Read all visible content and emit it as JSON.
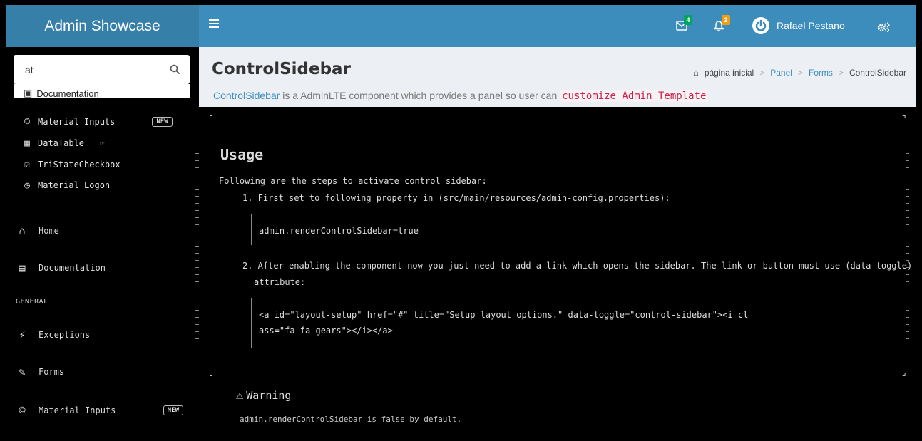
{
  "app": {
    "logo": "Admin Showcase"
  },
  "topbar": {
    "messages_count": "4",
    "notifications_count": "2",
    "user_name": "Rafael Pestano"
  },
  "search": {
    "value": "at"
  },
  "search_results": [
    {
      "label": "Documentation",
      "icon": "book-icon"
    },
    {
      "label": "Material Inputs",
      "icon": "copyright-icon",
      "tag": "NEW"
    },
    {
      "label": "DataTable",
      "icon": "table-icon"
    },
    {
      "label": "TriStateCheckbox",
      "icon": "check-square-icon"
    },
    {
      "label": "Material Logon",
      "icon": "clock-icon"
    }
  ],
  "menu": {
    "home": "Home",
    "documentation": "Documentation",
    "header_general": "GENERAL",
    "exceptions": "Exceptions",
    "forms": "Forms",
    "material_inputs": "Material Inputs",
    "material_inputs_tag": "NEW"
  },
  "page": {
    "title": "ControlSidebar",
    "breadcrumb": [
      "página inicial",
      "Panel",
      "Forms",
      "ControlSidebar"
    ],
    "intro_link": "ControlSidebar",
    "intro_text": " is a AdminLTE component which provides a panel so user can ",
    "intro_code": "customize Admin Template"
  },
  "usage": {
    "title": "Usage",
    "lead": "Following are the steps to activate control sidebar:",
    "step1": "1. First set to following property in (src/main/resources/admin-config.properties):",
    "code1": "admin.renderControlSidebar=true",
    "step2_line1": "2. After enabling the component now you just need to add a link which opens the sidebar. The link or button must use (data-toggle)",
    "step2_line2": "attribute:",
    "code2_line1": "<a id=\"layout-setup\" href=\"#\" title=\"Setup layout options.\" data-toggle=\"control-sidebar\"><i cl",
    "code2_line2": "ass=\"fa fa-gears\"></i></a>"
  },
  "warning": {
    "title": "Warning",
    "text": "admin.renderControlSidebar is false by default."
  }
}
